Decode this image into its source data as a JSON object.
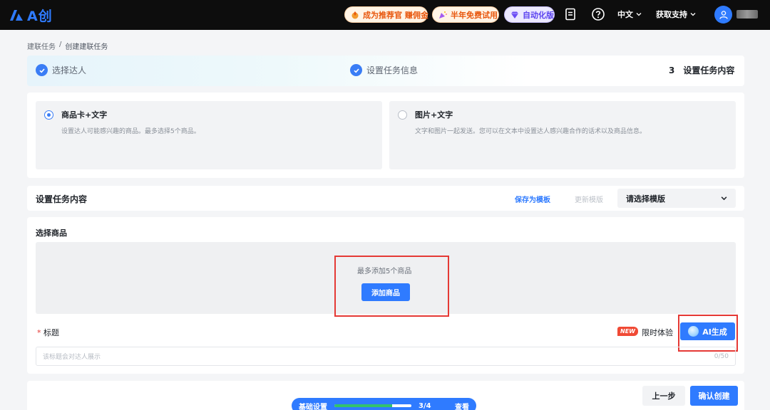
{
  "topbar": {
    "logo_text": "A创",
    "promo_pills": [
      {
        "label": "成为推荐官 赚佣金",
        "icon": "fire-coin-icon"
      },
      {
        "label": "半年免费试用",
        "icon": "party-popper-icon"
      },
      {
        "label": "自动化版",
        "icon": "diamond-icon"
      }
    ],
    "language": "中文",
    "support": "获取支持"
  },
  "breadcrumb": {
    "parent": "建联任务",
    "separator": "/",
    "current": "创建建联任务"
  },
  "steps": [
    {
      "label": "选择达人",
      "state": "done"
    },
    {
      "label": "设置任务信息",
      "state": "done"
    },
    {
      "number": "3",
      "label": "设置任务内容",
      "state": "active"
    }
  ],
  "options": [
    {
      "title": "商品卡+文字",
      "desc": "设置达人可能感兴趣的商品。最多选择5个商品。",
      "selected": true
    },
    {
      "title": "图片+文字",
      "desc": "文字和图片一起发送。您可以在文本中设置达人感兴趣合作的话术以及商品信息。",
      "selected": false
    }
  ],
  "content_header": {
    "title": "设置任务内容",
    "save_template": "保存为模板",
    "update_template": "更新模版",
    "template_select": "请选择模版"
  },
  "products": {
    "label": "选择商品",
    "hint": "最多添加5个商品",
    "add_button": "添加商品"
  },
  "title_field": {
    "required_mark": "*",
    "label": "标题",
    "new_badge": "NEW",
    "limited_text": "限时体验",
    "ai_button": "AI生成",
    "placeholder": "该标题会对达人展示",
    "counter": "0/50"
  },
  "footer": {
    "progress_label": "基础设置",
    "progress_count": "3/4",
    "progress_fraction": 0.75,
    "view_link": "查看",
    "prev_button": "上一步",
    "confirm_button": "确认创建"
  },
  "colors": {
    "accent": "#2f7bff",
    "highlight": "#e53935",
    "new_badge": "#f04a35"
  }
}
